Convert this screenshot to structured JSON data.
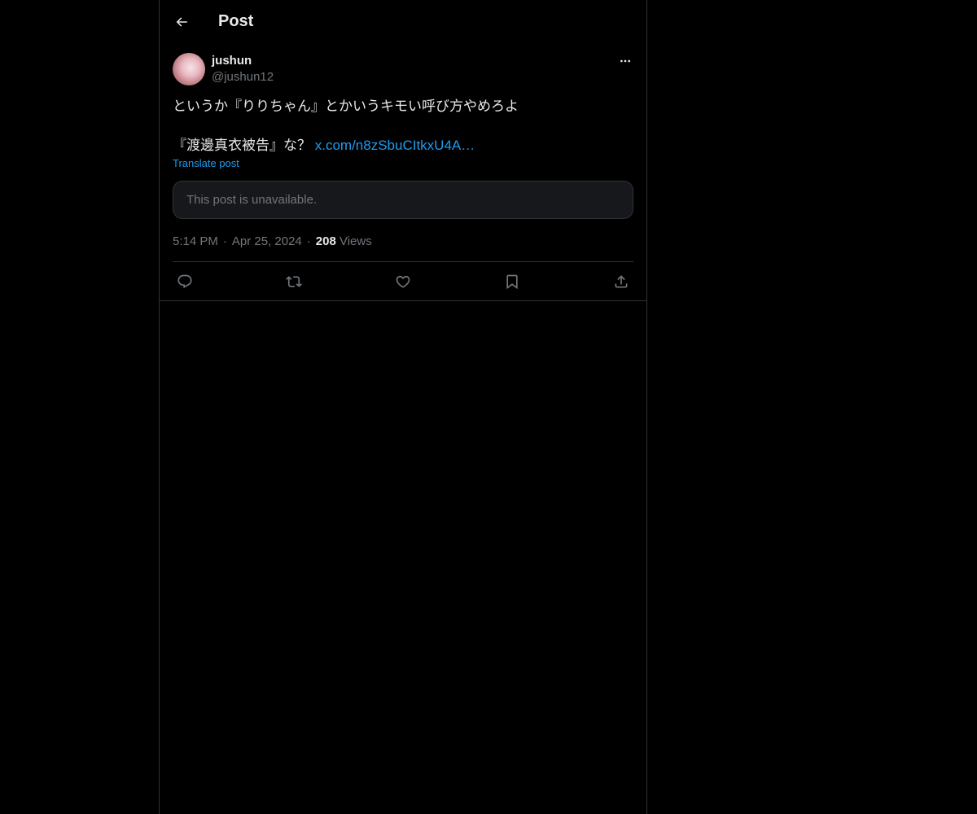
{
  "header": {
    "title": "Post",
    "back_icon": "arrow-left-icon"
  },
  "post": {
    "display_name": "jushun",
    "handle": "@jushun12",
    "text_line1": "というか『りりちゃん』とかいうキモい呼び方やめろよ",
    "text_line3_prefix": "『渡邊真衣被告』な？ ",
    "link_text": "x.com/n8zSbuCItkxU4A…",
    "translate_label": "Translate post",
    "quoted_unavailable": "This post is unavailable.",
    "time": "5:14 PM",
    "separator": "·",
    "date": "Apr 25, 2024",
    "views_count": "208",
    "views_label": "Views"
  },
  "actions": [
    "reply-icon",
    "repost-icon",
    "like-icon",
    "bookmark-icon",
    "share-icon"
  ],
  "colors": {
    "background": "#000000",
    "text": "#e7e9ea",
    "secondary": "#71767b",
    "accent": "#1d9bf0",
    "border": "#2f3336"
  }
}
